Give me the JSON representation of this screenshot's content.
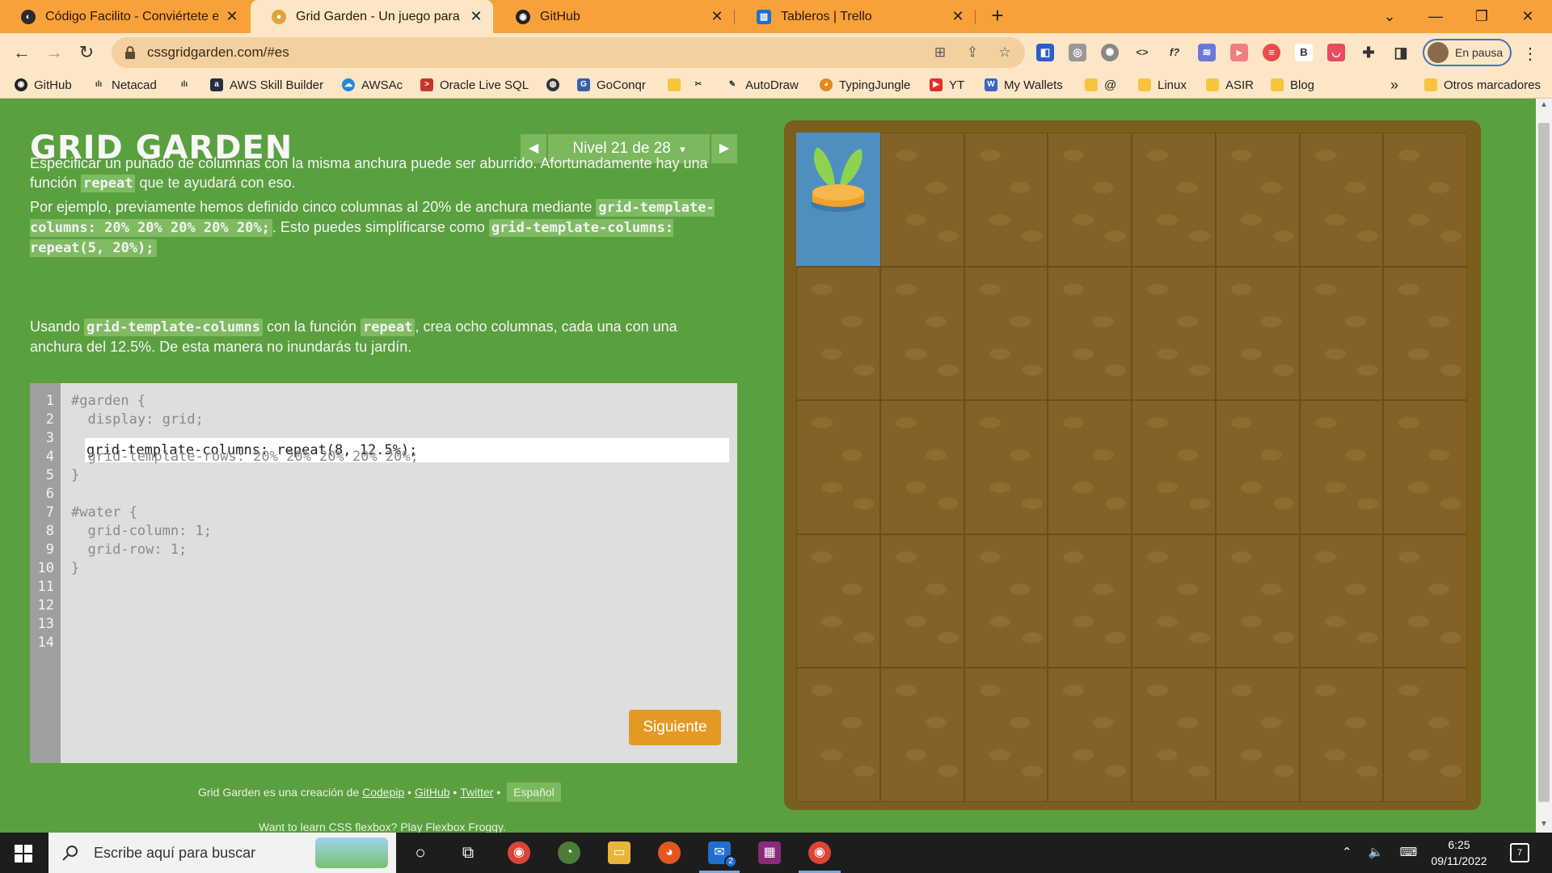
{
  "browser": {
    "tabs": [
      {
        "title": "Código Facilito - Conviértete en p",
        "close": "✕"
      },
      {
        "title": "Grid Garden - Un juego para apre",
        "close": "✕"
      },
      {
        "title": "GitHub",
        "close": "✕"
      },
      {
        "title": "Tableros | Trello",
        "close": "✕"
      }
    ],
    "new_tab": "+",
    "url": "cssgridgarden.com/#es",
    "profile_label": "En pausa",
    "bookmarks": [
      {
        "label": "GitHub"
      },
      {
        "label": "Netacad"
      },
      {
        "label": "AWS Skill Builder"
      },
      {
        "label": "AWSAc"
      },
      {
        "label": "Oracle Live SQL"
      },
      {
        "label": "GoConqr"
      },
      {
        "label": "AutoDraw"
      },
      {
        "label": "TypingJungle"
      },
      {
        "label": "YT"
      },
      {
        "label": "My Wallets"
      },
      {
        "label": "@"
      },
      {
        "label": "Linux"
      },
      {
        "label": "ASIR"
      },
      {
        "label": "Blog"
      }
    ],
    "bookmarks_more": "»",
    "other_bookmarks": "Otros marcadores"
  },
  "page": {
    "title": "GRID GARDEN",
    "level_label": "Nivel 21 de 28",
    "level_caret": "▾",
    "prev": "◀",
    "next": "▶",
    "p1_a": "Especificar un puñado de columnas con la misma anchura puede ser aburrido. Afortunadamente hay una función ",
    "p1_code": "repeat",
    "p1_b": " que te ayudará con eso.",
    "p2_a": "Por ejemplo, previamente hemos definido cinco columnas al 20% de anchura mediante ",
    "p2_code1": "grid-template-columns: 20% 20% 20% 20% 20%;",
    "p2_b": ". Esto puedes simplificarse como ",
    "p2_code2": "grid-template-columns: repeat(5, 20%);",
    "p3_a": "Usando ",
    "p3_code1": "grid-template-columns",
    "p3_b": " con la función ",
    "p3_code2": "repeat",
    "p3_c": ", crea ocho columnas, cada una con una anchura del 12.5%. De esta manera no inundarás tu jardín.",
    "editor": {
      "line_numbers": [
        "1",
        "2",
        "3",
        "4",
        "5",
        "6",
        "7",
        "8",
        "9",
        "10",
        "11",
        "12",
        "13",
        "14"
      ],
      "lines": [
        "#garden {",
        "  display: grid;",
        "",
        "  grid-template-rows: 20% 20% 20% 20% 20%;",
        "}",
        "",
        "#water {",
        "  grid-column: 1;",
        "  grid-row: 1;",
        "}"
      ],
      "input_value": "grid-template-columns: repeat(8, 12.5%);"
    },
    "next_button": "Siguiente",
    "credits_text": "Grid Garden es una creación de ",
    "credits_codepip": "Codepip",
    "credits_github": "GitHub",
    "credits_twitter": "Twitter",
    "credits_sep": " • ",
    "language": "Español",
    "froggy_text": "Want to learn CSS flexbox? Play ",
    "froggy_link": "Flexbox Froggy."
  },
  "taskbar": {
    "search_placeholder": "Escribe aquí para buscar",
    "time": "6:25",
    "date": "09/11/2022",
    "mail_badge": "2",
    "notif_count": "7"
  },
  "colors": {
    "tabbar": "#f8a13a",
    "page_bg": "#5aa03f",
    "soil": "#836127",
    "water": "#4f8fbf",
    "button": "#e39a24"
  }
}
